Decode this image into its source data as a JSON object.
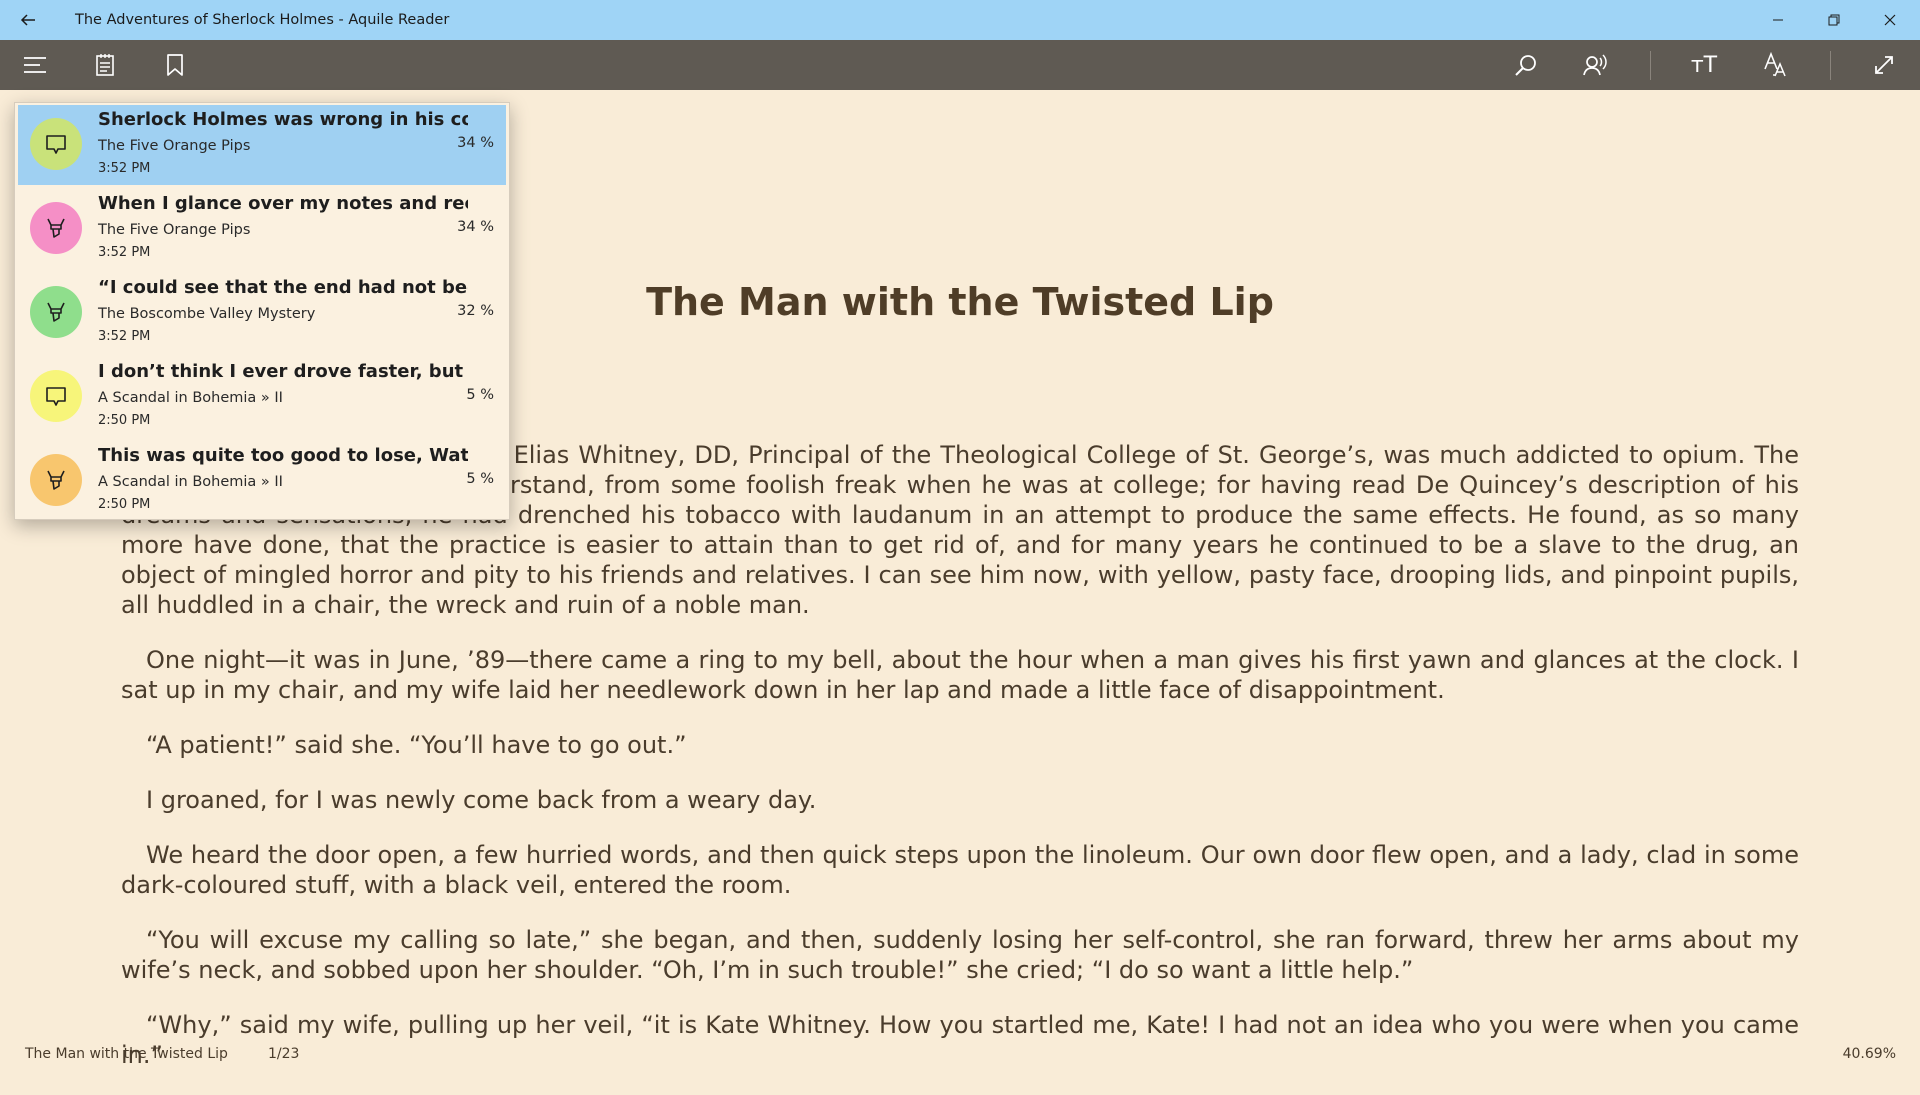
{
  "window": {
    "title": "The Adventures of Sherlock Holmes - Aquile Reader",
    "back_icon": "back-arrow-icon",
    "minimize_icon": "minimize-icon",
    "restore_icon": "restore-icon",
    "close_icon": "close-icon"
  },
  "toolbar": {
    "left_icons": [
      "menu-icon",
      "notes-icon",
      "bookmark-icon"
    ],
    "right_icons": [
      "search-icon",
      "read-aloud-icon",
      "font-size-icon",
      "text-appearance-icon",
      "fullscreen-icon"
    ],
    "font_size_label": "тТ"
  },
  "annotations": [
    {
      "quote": "Sherlock Holmes was wrong in his conj...",
      "chapter": "The Five Orange Pips",
      "time": "3:52 PM",
      "percent": "34 %",
      "type": "note",
      "color": "#c9e27a",
      "selected": true
    },
    {
      "quote": "When I glance over my notes and recor...",
      "chapter": "The Five Orange Pips",
      "time": "3:52 PM",
      "percent": "34 %",
      "type": "highlight",
      "color": "#f58fc6",
      "selected": false
    },
    {
      "quote": "“I could see that the end had not been i...",
      "chapter": "The Boscombe Valley Mystery",
      "time": "3:52 PM",
      "percent": "32 %",
      "type": "highlight",
      "color": "#8fde8c",
      "selected": false
    },
    {
      "quote": "I don’t think I ever drove faster, but the...",
      "chapter": "A Scandal in Bohemia » II",
      "time": "2:50 PM",
      "percent": "5 %",
      "type": "note",
      "color": "#f7f57a",
      "selected": false
    },
    {
      "quote": "This was quite too good to lose, Watson.",
      "chapter": "A Scandal in Bohemia » II",
      "time": "2:50 PM",
      "percent": "5 %",
      "type": "highlight",
      "color": "#f8c66e",
      "selected": false
    }
  ],
  "content": {
    "chapter_title": "The Man with the Twisted Lip",
    "paragraphs": [
      "Isa Whitney, brother of the late Elias Whitney, DD, Principal of the Theological College of St. George’s, was much addicted to opium. The habit grew upon him, as I understand, from some foolish freak when he was at college; for having read De Quincey’s description of his dreams and sensations, he had drenched his tobacco with laudanum in an attempt to produce the same effects. He found, as so many more have done, that the practice is easier to attain than to get rid of, and for many years he continued to be a slave to the drug, an object of mingled horror and pity to his friends and relatives. I can see him now, with yellow, pasty face, drooping lids, and pinpoint pupils, all huddled in a chair, the wreck and ruin of a noble man.",
      "One night—it was in June, ’89—there came a ring to my bell, about the hour when a man gives his first yawn and glances at the clock. I sat up in my chair, and my wife laid her needlework down in her lap and made a little face of disappointment.",
      "“A patient!” said she. “You’ll have to go out.”",
      "I groaned, for I was newly come back from a weary day.",
      "We heard the door open, a few hurried words, and then quick steps upon the linoleum. Our own door flew open, and a lady, clad in some dark-coloured stuff, with a black veil, entered the room.",
      "“You will excuse my calling so late,” she began, and then, suddenly losing her self-control, she ran forward, threw her arms about my wife’s neck, and sobbed upon her shoulder. “Oh, I’m in such trouble!” she cried; “I do so want a little help.”",
      "“Why,” said my wife, pulling up her veil, “it is Kate Whitney. How you startled me, Kate! I had not an idea who you were when you came in.”"
    ]
  },
  "footer": {
    "chapter": "The Man with the Twisted Lip",
    "page": "1/23",
    "progress": "40.69%"
  },
  "colors": {
    "titlebar": "#9fd4f6",
    "toolbar": "#5f5a53",
    "page_background": "#f9ecd7",
    "text": "#4a3c2c",
    "selected_item": "#9fd0f2"
  }
}
